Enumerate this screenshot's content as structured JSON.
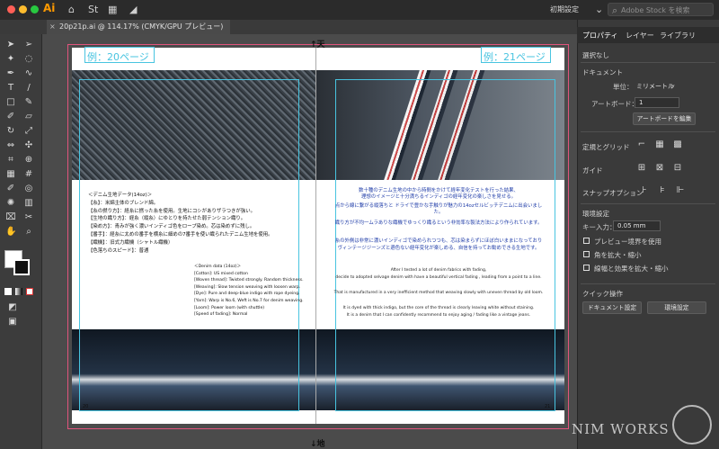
{
  "app": {
    "name": "Ai",
    "workspace": "初期設定",
    "search_placeholder": "Adobe Stock を検索"
  },
  "document_tab": {
    "title": "20p21p.ai @ 114.17% (CMYK/GPU プレビュー)"
  },
  "canvas": {
    "top_marker": "↑天",
    "bottom_marker": "↓地",
    "left_page_label": "例：20ページ",
    "right_page_label": "例：21ページ",
    "left_page_number": "20",
    "right_page_number": "21",
    "left_jp_lines": [
      "＜デニム生地データ(14oz)＞",
      "【糸】：米綿主体のブレンド綿。",
      "【糸の撚り方】：経糸に撚った糸を使用。生地にコシがありザラつきが強い。",
      "【生地の織り方】：経糸（縦糸）にゆとりを持たせた弱テンション織り。",
      "【染め方】：青みが強く濃いインディゴ色をロープ染め。芯は染めずに残し。",
      "【番手】：経糸に太めの番手を横糸に細めの7番手を使い織られたデニム生地を使用。",
      "【織機】：旧式力織機（シャトル織機）",
      "【色落ちのスピード】：普通"
    ],
    "left_en_lines": [
      "＜Denim data (14oz)＞",
      "[Cotton]: US mixed cotton",
      "[Woven thread]: Twisted strongly. Random thickness.",
      "[Weaving]: Slow tension weaving with loosen warp.",
      "[Dye]: Pure and deep-blue indigo with rope dyeing.",
      "[Yarn]: Warp is No.6, Weft is No.7 for denim weaving.",
      "[Loom]: Power loom (with shuttle)",
      "[Speed of fading]: Normal"
    ],
    "right_jp_lines": [
      "数十種のデニム生地の中から時間をかけて経年変化テストを行った結果、",
      "理想のイメージと十分満ちるインディゴの経年変化の楽しさを見せる。",
      "点から線に繋がる縦落ちと ドライで豊かな手触りが魅力の14ozセルビッチデニムに出会いました。",
      "織り方が不均一ムラありな織機でゆっくり織るという非効率な製法方法により作られています。",
      "糸の外側は非常に濃いインディゴで染められつつも、芯は染まらずにほぼ白いままになっており",
      "ヴィンテージジーンズと遜色ない経年変化が楽しめる、自信を持ってお勧めできる生地です。"
    ],
    "right_en_lines": [
      "After I tested a lot of denim fabrics with fading,",
      "decide to adopted selvage denim with have a beautiful vertical fading , leading from a point to a line.",
      "That is manufactured in a very inefficient method that weaving slowly with uneven thread by old loom.",
      "It is dyed with thick indigo, but the core of the thread is clearly leaving white without staining.",
      "It is a denim that I can confidently recommend to enjoy aging / fading like a vintage jeans."
    ]
  },
  "panel": {
    "tabs": [
      "プロパティ",
      "レイヤー",
      "ライブラリ"
    ],
    "no_selection": "選択なし",
    "document_heading": "ドキュメント",
    "unit_label": "単位：",
    "unit_value": "ミリメートル",
    "artboard_label": "アートボード：",
    "artboard_value": "1",
    "edit_artboard_button": "アートボードを編集",
    "rulers_grid": "定規とグリッド",
    "guides": "ガイド",
    "snap_options": "スナップオプション",
    "preferences_heading": "環境設定",
    "key_increment_label": "キー入力：",
    "key_increment_value": "0.05 mm",
    "checkbox_preview_bounds": "プレビュー境界を使用",
    "checkbox_scale_corners": "角を拡大・縮小",
    "checkbox_scale_strokes": "線幅と効果を拡大・縮小",
    "quick_actions_heading": "クイック操作",
    "document_settings_button": "ドキュメント設定",
    "preferences_button": "環境設定"
  },
  "watermark": {
    "text": "NIM WORKS"
  },
  "colors": {
    "guide": "#48c4e0",
    "bleed": "#e1547d",
    "right_text": "#1f3ca8",
    "accent": "#ff9a00"
  }
}
